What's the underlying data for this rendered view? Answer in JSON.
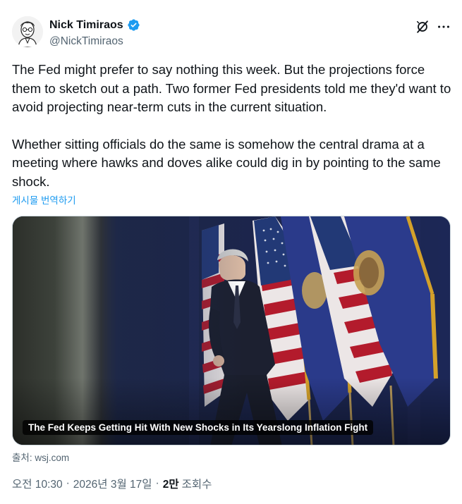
{
  "author": {
    "name": "Nick Timiraos",
    "handle": "@NickTimiraos",
    "verified": true
  },
  "tweet": {
    "paragraphs": [
      "The Fed might prefer to say nothing this week. But the projections force them to sketch out a path. Two former Fed presidents told me they'd want to avoid projecting near-term cuts in the current situation.",
      "Whether sitting officials do the same is somehow the central drama at a meeting where hawks and doves alike could dig in by pointing to the same shock."
    ],
    "translate_label": "게시물 번역하기"
  },
  "card": {
    "title": "The Fed Keeps Getting Hit With New Shocks in Its Yearslong Inflation Fight",
    "source_label": "출처: wsj.com"
  },
  "meta": {
    "time": "오전 10:30",
    "date": "2026년 3월 17일",
    "views_count": "2만",
    "views_label": "조회수"
  },
  "icons": {
    "verified": "verified-badge-icon",
    "grok": "grok-icon",
    "more": "more-options-icon"
  },
  "colors": {
    "accent": "#1d9bf0",
    "secondary_text": "#536471",
    "primary_text": "#0f1419"
  }
}
